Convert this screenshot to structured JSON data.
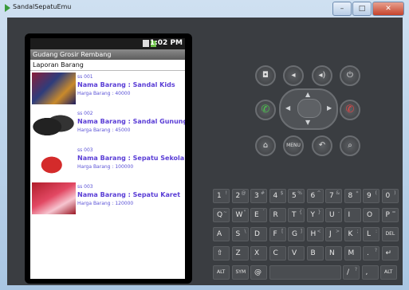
{
  "window": {
    "title": "SandalSepatuEmu",
    "min_label": "–",
    "max_label": "□",
    "close_label": "✕"
  },
  "status": {
    "time": "1:02 PM"
  },
  "app": {
    "title": "Gudang Grosir Rembang",
    "subheader": "Laporan Barang"
  },
  "items": [
    {
      "code": "ss 001",
      "name": "Nama Barang  : Sandal Kids",
      "price": "Harga Barang : 40000"
    },
    {
      "code": "ss 002",
      "name": "Nama Barang  : Sandal Gunung",
      "price": "Harga Barang : 45000"
    },
    {
      "code": "ss 003",
      "name": "Nama Barang  : Sepatu  Sekolah",
      "price": "Harga Barang : 100000"
    },
    {
      "code": "ss 003",
      "name": "Nama Barang  : Sepatu Karet",
      "price": "Harga Barang : 120000"
    }
  ],
  "controls": {
    "camera": "camera-icon",
    "vol_down": "volume-down-icon",
    "vol_up": "volume-up-icon",
    "power": "power-icon",
    "call": "call-icon",
    "end_call": "end-call-icon",
    "home": "home-icon",
    "menu_label": "MENU",
    "back": "back-icon",
    "search": "search-icon"
  },
  "keyboard": {
    "row1": [
      [
        "1",
        "!"
      ],
      [
        "2",
        "@"
      ],
      [
        "3",
        "#"
      ],
      [
        "4",
        "$"
      ],
      [
        "5",
        "%"
      ],
      [
        "6",
        "^"
      ],
      [
        "7",
        "&"
      ],
      [
        "8",
        "*"
      ],
      [
        "9",
        "("
      ],
      [
        "0",
        ")"
      ]
    ],
    "row2": [
      [
        "Q",
        "~"
      ],
      [
        "W",
        "\""
      ],
      [
        "E",
        "´"
      ],
      [
        "R",
        ""
      ],
      [
        "T",
        "{"
      ],
      [
        "Y",
        "}"
      ],
      [
        "U",
        "-"
      ],
      [
        "I",
        ""
      ],
      [
        "O",
        ""
      ],
      [
        "P",
        "="
      ]
    ],
    "row3": [
      [
        "A",
        ""
      ],
      [
        "S",
        "\\"
      ],
      [
        "D",
        ""
      ],
      [
        "F",
        "["
      ],
      [
        "G",
        "]"
      ],
      [
        "H",
        "<"
      ],
      [
        "J",
        ">"
      ],
      [
        "K",
        ";"
      ],
      [
        "L",
        ":"
      ],
      [
        "DEL",
        ""
      ]
    ],
    "row4": [
      [
        "⇧",
        ""
      ],
      [
        "Z",
        ""
      ],
      [
        "X",
        ""
      ],
      [
        "C",
        ""
      ],
      [
        "V",
        ""
      ],
      [
        "B",
        ""
      ],
      [
        "N",
        ""
      ],
      [
        "M",
        ""
      ],
      [
        ".",
        "?"
      ],
      [
        "↵",
        ""
      ]
    ],
    "row5": [
      [
        "ALT",
        ""
      ],
      [
        "SYM",
        ""
      ],
      [
        "@",
        ""
      ],
      [
        "",
        ""
      ],
      [
        "",
        ""
      ],
      [
        "",
        ""
      ],
      [
        "",
        ""
      ],
      [
        "/",
        "?"
      ],
      [
        ",",
        ""
      ],
      [
        "ALT",
        ""
      ]
    ]
  }
}
